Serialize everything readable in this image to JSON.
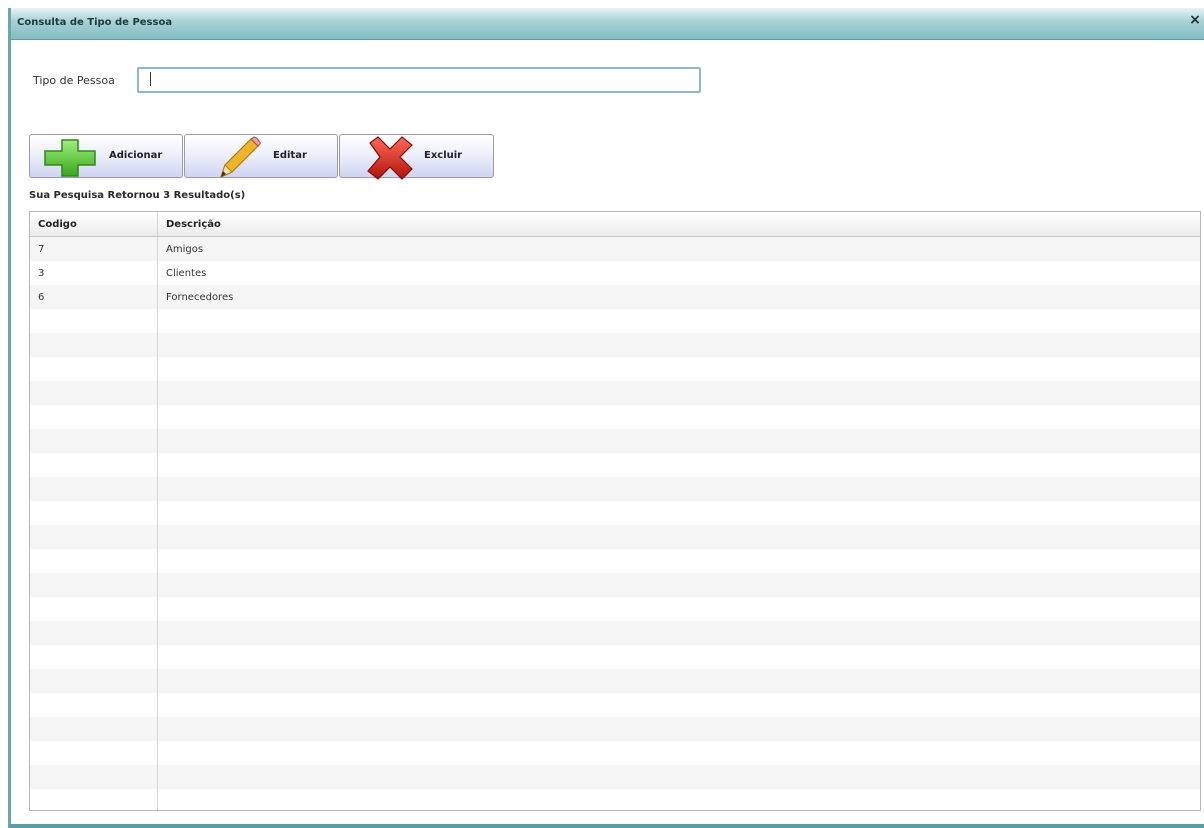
{
  "window": {
    "title": "Consulta de Tipo de Pessoa",
    "close_glyph": "×"
  },
  "filter": {
    "label": "Tipo de Pessoa",
    "value": ""
  },
  "toolbar": {
    "add_label": "Adicionar",
    "add_icon": "plus-icon",
    "edit_label": "Editar",
    "edit_icon": "pencil-icon",
    "delete_label": "Excluir",
    "delete_icon": "x-icon"
  },
  "results": {
    "summary": "Sua Pesquisa Retornou 3 Resultado(s)"
  },
  "grid": {
    "columns": [
      "Codigo",
      "Descrição"
    ],
    "rows": [
      {
        "codigo": "7",
        "descricao": "Amigos"
      },
      {
        "codigo": "3",
        "descricao": "Clientes"
      },
      {
        "codigo": "6",
        "descricao": "Fornecedores"
      }
    ]
  },
  "colors": {
    "titlebar": "#7fbcc0",
    "input_border": "#8ab6d8",
    "button_gradient_end": "#cfd4f1",
    "row_alt": "#f5f5f5"
  }
}
